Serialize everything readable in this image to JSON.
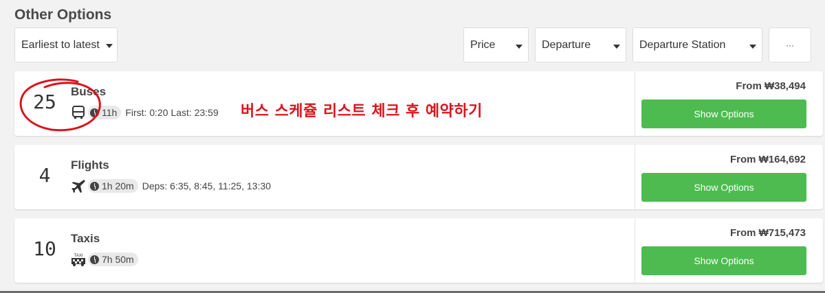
{
  "header": {
    "title": "Other Options"
  },
  "filters": {
    "sort": "Earliest to latest",
    "price": "Price",
    "departure": "Departure",
    "departure_station": "Departure Station",
    "more": "···"
  },
  "options": [
    {
      "count": "25",
      "name": "Buses",
      "icon": "bus-icon",
      "duration": "11h",
      "details": "First: 0:20 Last: 23:59",
      "price": "From ₩38,494",
      "button": "Show Options"
    },
    {
      "count": "4",
      "name": "Flights",
      "icon": "airplane-icon",
      "duration": "1h 20m",
      "details": "Deps: 6:35, 8:45, 11:25, 13:30",
      "price": "From ₩164,692",
      "button": "Show Options"
    },
    {
      "count": "10",
      "name": "Taxis",
      "icon": "taxi-icon",
      "duration": "7h 50m",
      "details": "",
      "price": "From ₩715,473",
      "button": "Show Options",
      "icon_label": "TAXI"
    }
  ],
  "annotation": {
    "text": "버스 스케쥴 리스트 체크 후 예약하기",
    "color": "#d9131c"
  },
  "colors": {
    "button": "#4dbb4f",
    "background": "#f2f2f2"
  }
}
